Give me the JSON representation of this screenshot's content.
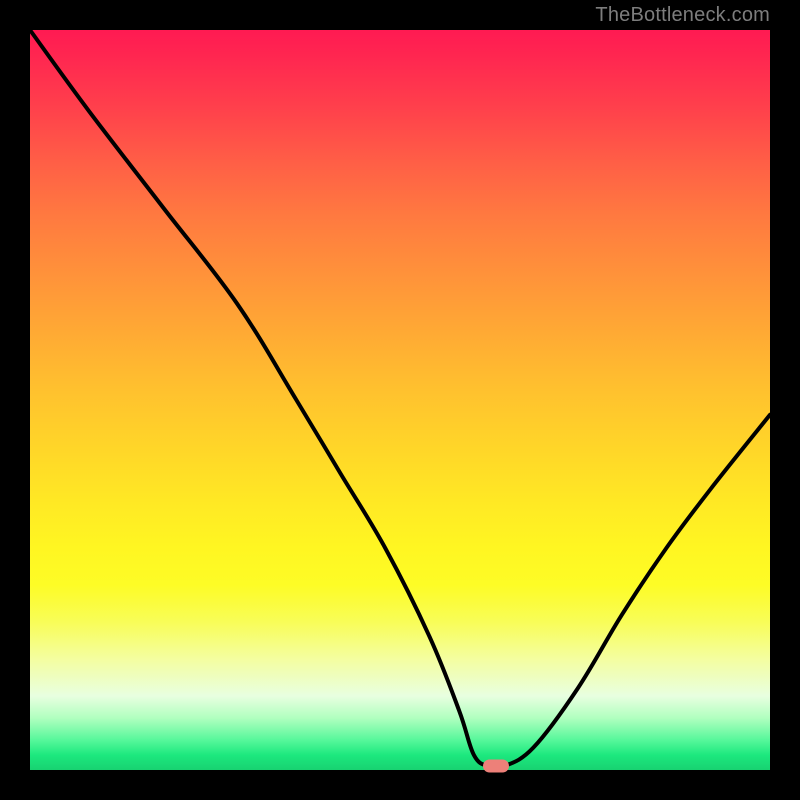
{
  "watermark": "TheBottleneck.com",
  "chart_data": {
    "type": "line",
    "title": "",
    "xlabel": "",
    "ylabel": "",
    "xlim": [
      0,
      100
    ],
    "ylim": [
      0,
      100
    ],
    "x": [
      0,
      8,
      18,
      28,
      36,
      42,
      48,
      54,
      58,
      60,
      62,
      64,
      68,
      74,
      80,
      86,
      92,
      100
    ],
    "y": [
      100,
      89,
      76,
      63,
      50,
      40,
      30,
      18,
      8,
      2,
      0.5,
      0.5,
      3,
      11,
      21,
      30,
      38,
      48
    ],
    "marker_x": 63,
    "marker_y": 0.6,
    "gradient_stops": [
      {
        "pos": 0,
        "color": "#ff1a52"
      },
      {
        "pos": 25,
        "color": "#ff7940"
      },
      {
        "pos": 50,
        "color": "#ffc22e"
      },
      {
        "pos": 75,
        "color": "#fdfc26"
      },
      {
        "pos": 100,
        "color": "#18d271"
      }
    ]
  }
}
